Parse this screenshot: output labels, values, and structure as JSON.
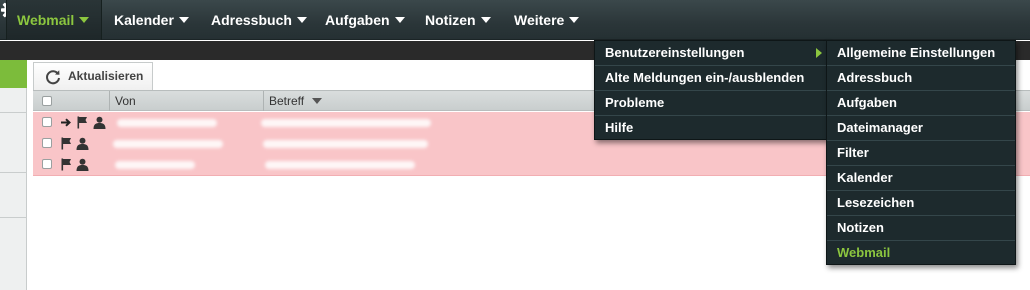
{
  "nav": {
    "items": [
      {
        "label": "Webmail",
        "active": true
      },
      {
        "label": "Kalender"
      },
      {
        "label": "Adressbuch"
      },
      {
        "label": "Aufgaben"
      },
      {
        "label": "Notizen"
      },
      {
        "label": "Weitere"
      }
    ],
    "gear_icon": "gear-icon"
  },
  "toolbar": {
    "refresh_label": "Aktualisieren",
    "refresh_icon": "refresh-icon"
  },
  "list": {
    "columns": {
      "from": "Von",
      "subject": "Betreff"
    },
    "sort_icon": "sort-descending-icon",
    "rows": [
      {
        "icons": [
          "forwarded-icon",
          "flag-icon",
          "contact-icon"
        ],
        "from": "",
        "subject": "",
        "status_color": "#f9c5c8"
      },
      {
        "icons": [
          "flag-icon",
          "contact-icon"
        ],
        "from": "",
        "subject": "",
        "status_color": "#f9c5c8"
      },
      {
        "icons": [
          "flag-icon",
          "contact-icon"
        ],
        "from": "",
        "subject": "",
        "status_color": "#f9c5c8"
      }
    ]
  },
  "menu": {
    "items": [
      {
        "label": "Benutzereinstellungen",
        "has_submenu": true
      },
      {
        "label": "Alte Meldungen ein-/ausblenden"
      },
      {
        "label": "Probleme"
      },
      {
        "label": "Hilfe"
      }
    ],
    "submenu": [
      {
        "label": "Allgemeine Einstellungen"
      },
      {
        "label": "Adressbuch"
      },
      {
        "label": "Aufgaben"
      },
      {
        "label": "Dateimanager"
      },
      {
        "label": "Filter"
      },
      {
        "label": "Kalender"
      },
      {
        "label": "Lesezeichen"
      },
      {
        "label": "Notizen"
      },
      {
        "label": "Webmail",
        "active": true
      }
    ]
  },
  "colors": {
    "accent": "#8cc63f",
    "nav_background": "#2b3639",
    "menu_background": "#1d2a2d",
    "flagged_row": "#f9c5c8"
  }
}
